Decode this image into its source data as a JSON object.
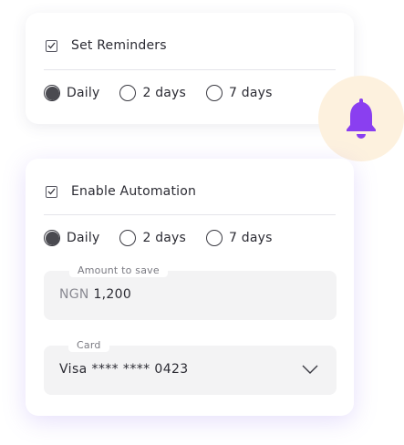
{
  "reminders": {
    "checkbox_label": "Set Reminders",
    "checked": true,
    "options": [
      "Daily",
      "2 days",
      "7 days"
    ],
    "selected": "Daily"
  },
  "automation": {
    "checkbox_label": "Enable Automation",
    "checked": true,
    "options": [
      "Daily",
      "2 days",
      "7 days"
    ],
    "selected": "Daily",
    "amount_field": {
      "label": "Amount to save",
      "currency": "NGN",
      "value": "1,200"
    },
    "card_field": {
      "label": "Card",
      "value": "Visa **** **** 0423"
    }
  },
  "bell_badge": {
    "icon": "bell-icon",
    "icon_color": "#8a3ff0",
    "background_color": "#fdf1de"
  },
  "colors": {
    "accent_purple": "#8a3ff0",
    "field_background": "#f3f3f4"
  }
}
